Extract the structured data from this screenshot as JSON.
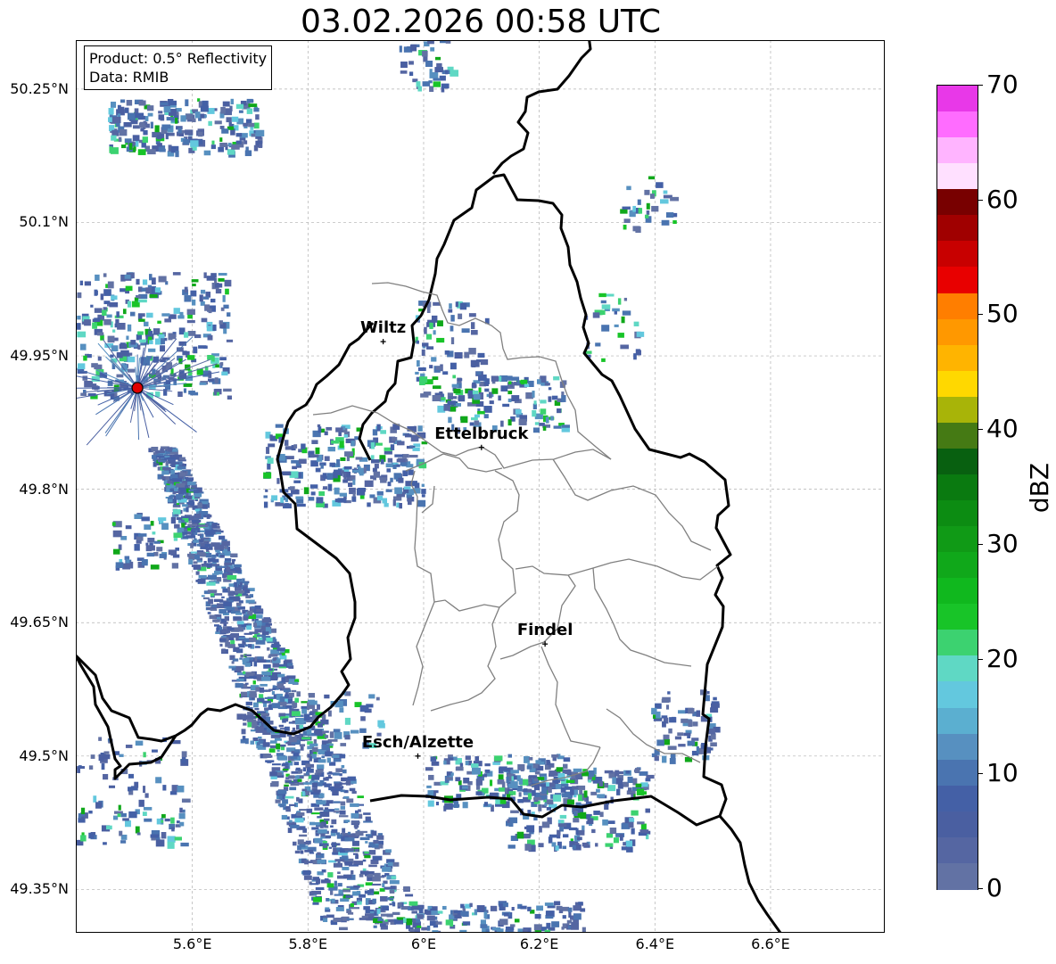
{
  "title": "03.02.2026 00:58 UTC",
  "info": {
    "product": "Product: 0.5° Reflectivity",
    "data": "Data: RMIB"
  },
  "axes": {
    "lat_ticks": [
      "50.25°N",
      "50.1°N",
      "49.95°N",
      "49.8°N",
      "49.65°N",
      "49.5°N",
      "49.35°N"
    ],
    "lon_ticks": [
      "5.6°E",
      "5.8°E",
      "6°E",
      "6.2°E",
      "6.4°E",
      "6.6°E"
    ]
  },
  "cities": [
    {
      "name": "Wiltz",
      "lon": 5.93,
      "lat": 49.966
    },
    {
      "name": "Ettelbruck",
      "lon": 6.1,
      "lat": 49.847
    },
    {
      "name": "Findel",
      "lon": 6.21,
      "lat": 49.626
    },
    {
      "name": "Esch/Alzette",
      "lon": 5.99,
      "lat": 49.5
    }
  ],
  "radar_site": {
    "lon": 5.505,
    "lat": 49.914,
    "color": "#e00000"
  },
  "colorbar": {
    "label": "dBZ",
    "min": 0,
    "max": 70,
    "tick_labels": [
      "0",
      "10",
      "20",
      "30",
      "40",
      "50",
      "60",
      "70"
    ],
    "colors": [
      "#6272a4",
      "#5566a2",
      "#4a5fa1",
      "#4460a6",
      "#4a74b0",
      "#5790c0",
      "#5bafd0",
      "#63c8de",
      "#5fd8c4",
      "#3cd270",
      "#18c428",
      "#10b81e",
      "#10a81a",
      "#109a16",
      "#0c8c12",
      "#0a7a10",
      "#086010",
      "#457a14",
      "#a8b408",
      "#ffd800",
      "#ffb400",
      "#ff9800",
      "#ff7e00",
      "#e80000",
      "#c80000",
      "#a00000",
      "#780000",
      "#ffe0ff",
      "#ffb4ff",
      "#ff6cff",
      "#e838e8"
    ]
  },
  "colors": {
    "border": "#000000",
    "canton_lines": "#808080",
    "grid": "#b0b0b0"
  }
}
